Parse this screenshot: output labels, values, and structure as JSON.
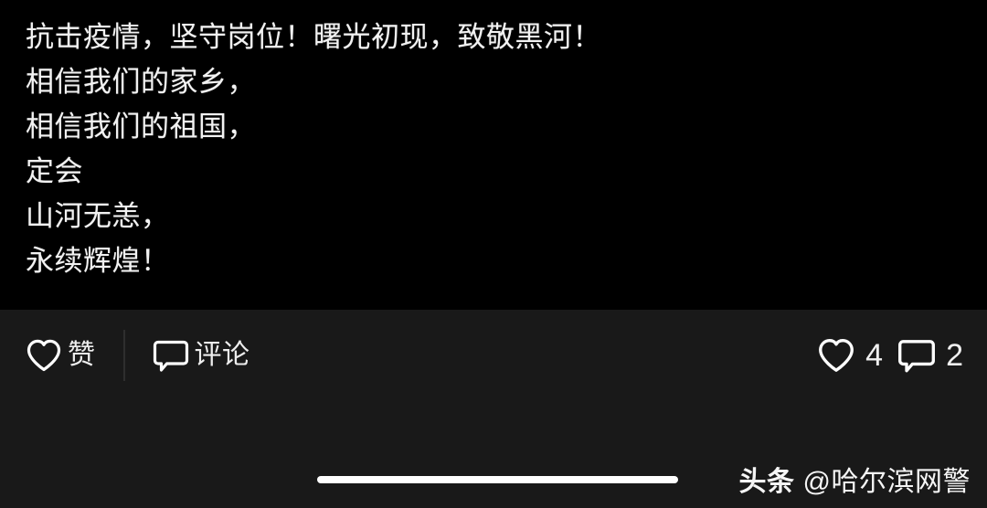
{
  "post": {
    "lines": [
      "抗击疫情，坚守岗位！曙光初现，致敬黑河！",
      "相信我们的家乡，",
      "相信我们的祖国，",
      "定会",
      "山河无恙，",
      "永续辉煌！"
    ]
  },
  "action_bar": {
    "like_button": {
      "icon": "heart-icon",
      "label": "赞"
    },
    "comment_button": {
      "icon": "comment-icon",
      "label": "评论"
    },
    "counts": {
      "like": {
        "icon": "heart-icon",
        "value": "4"
      },
      "comment": {
        "icon": "comment-icon",
        "value": "2"
      }
    }
  },
  "watermark": {
    "brand": "头条",
    "handle": "@哈尔滨网警"
  },
  "system": {
    "home_indicator": "home-indicator-bar"
  },
  "colors": {
    "background": "#000000",
    "panel": "#191919",
    "text": "#f2f2f2",
    "icon_stroke": "#ffffff",
    "divider": "#2e2e2e",
    "home_indicator": "#ffffff"
  }
}
